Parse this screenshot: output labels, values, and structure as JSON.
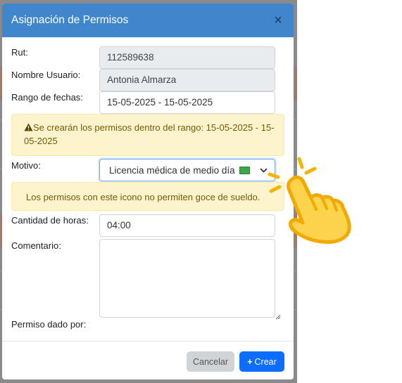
{
  "modal": {
    "title": "Asignación de Permisos",
    "close_glyph": "×"
  },
  "form": {
    "rut": {
      "label": "Rut:",
      "value": "112589638"
    },
    "nombre_usuario": {
      "label": "Nombre Usuario:",
      "value": "Antonia Almarza"
    },
    "rango_fechas": {
      "label": "Rango de fechas:",
      "value": "15-05-2025 - 15-05-2025"
    },
    "rango_alert": "Se crearán los permisos dentro del rango: 15-05-2025 - 15-05-2025",
    "motivo": {
      "label": "Motivo:",
      "selected": "Licencia médica de medio día"
    },
    "motivo_alert": "Los permisos con este icono no permiten goce de sueldo.",
    "cantidad_horas": {
      "label": "Cantidad de horas:",
      "value": "04:00"
    },
    "comentario": {
      "label": "Comentario:",
      "value": ""
    },
    "permiso_dado_por": {
      "label": "Permiso dado por:"
    }
  },
  "footer": {
    "cancel_label": "Cancelar",
    "create_label": "Crear",
    "create_icon": "+"
  },
  "colors": {
    "header": "#3f86cc",
    "primary": "#0d6efd",
    "alert_bg": "#fdf3cd",
    "alert_text": "#745b08"
  },
  "icons": [
    "close-icon",
    "warning-icon",
    "money-icon",
    "chevron-down-icon",
    "plus-icon",
    "pointing-hand-icon"
  ]
}
